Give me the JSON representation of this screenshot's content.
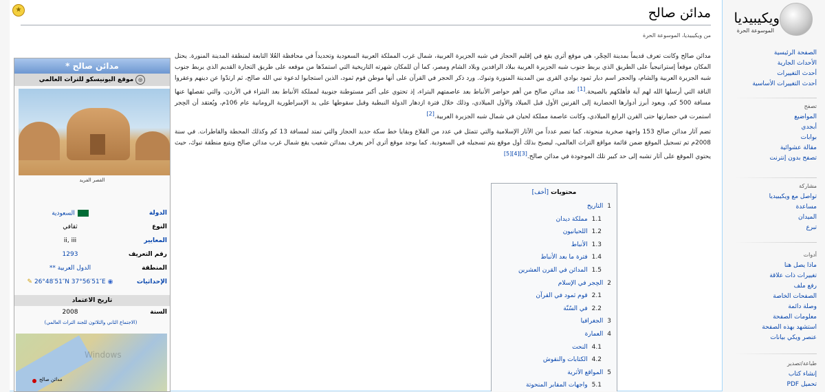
{
  "sidebar": {
    "logo_wordmark": "ويكيبيديا",
    "logo_tagline": "الموسوعة الحرة",
    "nav": [
      "الصفحة الرئيسية",
      "الأحداث الجارية",
      "أحدث التغييرات",
      "أحدث التغييرات الأساسية"
    ],
    "browse_heading": "تصفح",
    "browse": [
      "المواضيع",
      "أبجدي",
      "بوابات",
      "مقالة عشوائية",
      "تصفح بدون إنترنت"
    ],
    "participate_heading": "مشاركة",
    "participate": [
      "تواصل مع ويكيبيديا",
      "مساعدة",
      "الميدان",
      "تبرع"
    ],
    "tools_heading": "أدوات",
    "tools": [
      "ماذا يصل هنا",
      "تغييرات ذات علاقة",
      "رفع ملف",
      "الصفحات الخاصة",
      "وصلة دائمة",
      "معلومات الصفحة",
      "استشهد بهذه الصفحة",
      "عنصر ويكي بيانات"
    ],
    "print_heading": "طباعة/تصدير",
    "print": [
      "إنشاء كتاب",
      "تحميل PDF"
    ]
  },
  "article": {
    "title": "مدائن صالح",
    "from": "من ويكيبيديا، الموسوعة الحرة",
    "p1": "مدائن صالح وكانت تعرف قديماً بمدينة الحِجْر، هي موقع أثري يقع في إقليم الحجاز في شبه الجزيرة العربية، شمال غرب المملكة العربية السعودية وتحديداً في محافظة العُلا التابعة لمنطقة المدينة المنورة. يحتل المكان موقعاً إستراتيجياً على الطريق الذي يربط جنوب شبه الجزيرة العربية ببلاد الرافدين وبلاد الشام ومصر، كما أن للمكان شهرته التاريخية التي استمدّها من موقعه على طريق التجارة القديم الذي يربط جنوب شبه الجزيرة العربية والشام، والحجر اسم ديار ثمود بوادي القرى بين المدينة المنورة وتبوك. ورد ذكر الحجر في القرآن على أنها موطن قوم ثمود، الذين استجابوا لدعوة نبي الله صالح، ثم ارتدّوا عن دينهم وعقروا الناقة التي أرسلها الله لهم آية فأهلكهم بالصيحة.",
    "p1_b": "تعد مدائن صالح من أهم حواضر الأنباط بعد عاصمتهم البتراء، إذ تحتوي على أكبر مستوطنة جنوبية لمملكة الأنباط بعد البتراء في الأردن، والتي تفصلها عنها مسافة 500 كم، ويعود أبرز أدوارها الحضارية إلى القرنين الأول قبل الميلاد والأول الميلادي، وذلك خلال فترة ازدهار الدولة النبطية وقبل سقوطها على يد الإمبراطورية الرومانية عام 106م، ويُعتقد أن الحِجر استمرت في حضارتها حتى القرن الرابع الميلادي، وكانت عاصمة مملكة لحيان في شمال شبه الجزيرة العربية.",
    "ref1": "[1]",
    "ref2": "[2]",
    "p2": "تضم آثار مدائن صالح 153 واجهة صخرية منحوتة، كما تضم عدداً من الآثار الإسلامية والتي تتمثل في عدد من القلاع وبقايا خط سكة حديد الحجاز والتي تمتد لمسافة 13 كم وكذلك المحطة والقاطرات. في سنة 2008م تم تسجيل الموقع ضمن قائمة مواقع التراث العالمي، ليصبح بذلك أول موقع يتم تسجيله في السعودية. كما يوجد موقع أثري آخر يعرف بمدائن شعيب يقع شمال غرب مدائن صالح ويتبع منطقة تبوك، حيث يحتوي الموقع على آثار تشبه إلى حد كبير تلك الموجودة في مدائن صالح.",
    "ref3": "[3]",
    "ref4": "[4]",
    "ref5": "[5]"
  },
  "infobox": {
    "title": "مدائن صالح *",
    "subtitle": "موقع اليونيسكو للتراث العالمي",
    "photo_caption": "القصر الفريد",
    "rows": [
      {
        "k": "الدولة",
        "v": "السعودية"
      },
      {
        "k": "النوع",
        "v": "ثقافي"
      },
      {
        "k": "المعايير",
        "v": "ii, iii"
      },
      {
        "k": "رقم التعريف",
        "v": "1293"
      },
      {
        "k": "المنطقة",
        "v": "الدول العربية **"
      },
      {
        "k": "الإحداثيات",
        "v": "26°48′51″N 37°56′51″E"
      }
    ],
    "section_title": "تاريخ الاعتماد",
    "year_label": "السنة",
    "year_value": "2008",
    "session_note": "(الاجتماع الثاني والثلاثون للجنة التراث العالمي)",
    "map_label": "مدائن صالح",
    "map_watermark": "Windows"
  },
  "toc": {
    "title": "محتويات",
    "toggle": "[أخف]",
    "items": [
      {
        "n": "1",
        "t": "التاريخ",
        "level": 1
      },
      {
        "n": "1.1",
        "t": "مملكة ديدان",
        "level": 2
      },
      {
        "n": "1.2",
        "t": "اللحيانيون",
        "level": 2
      },
      {
        "n": "1.3",
        "t": "الأنباط",
        "level": 2
      },
      {
        "n": "1.4",
        "t": "فترة ما بعد الأنباط",
        "level": 2
      },
      {
        "n": "1.5",
        "t": "المدائن في القرن العشرين",
        "level": 2
      },
      {
        "n": "2",
        "t": "الحِجر في الإسلام",
        "level": 1
      },
      {
        "n": "2.1",
        "t": "قوم ثمود في القرآن",
        "level": 2
      },
      {
        "n": "2.2",
        "t": "في السُنّة",
        "level": 2
      },
      {
        "n": "3",
        "t": "الجغرافيا",
        "level": 1
      },
      {
        "n": "4",
        "t": "العمارة",
        "level": 1
      },
      {
        "n": "4.1",
        "t": "النحت",
        "level": 2
      },
      {
        "n": "4.2",
        "t": "الكتابات والنقوش",
        "level": 2
      },
      {
        "n": "5",
        "t": "المواقع الأثرية",
        "level": 1
      },
      {
        "n": "5.1",
        "t": "واجهات المقابر المنحوتة",
        "level": 2
      }
    ]
  }
}
